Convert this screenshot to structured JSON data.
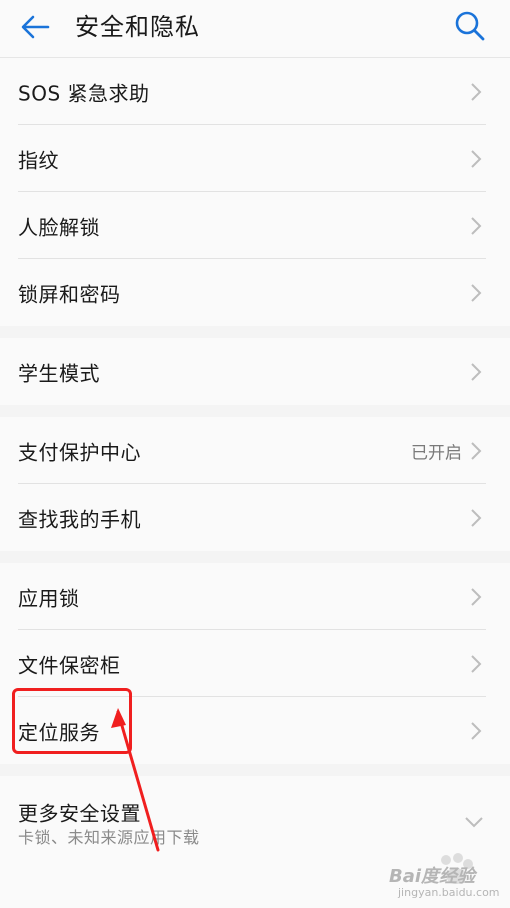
{
  "header": {
    "title": "安全和隐私"
  },
  "groups": [
    {
      "items": [
        {
          "label": "SOS 紧急求助"
        },
        {
          "label": "指纹"
        },
        {
          "label": "人脸解锁"
        },
        {
          "label": "锁屏和密码"
        }
      ]
    },
    {
      "items": [
        {
          "label": "学生模式"
        }
      ]
    },
    {
      "items": [
        {
          "label": "支付保护中心",
          "value": "已开启"
        },
        {
          "label": "查找我的手机"
        }
      ]
    },
    {
      "items": [
        {
          "label": "应用锁"
        },
        {
          "label": "文件保密柜"
        },
        {
          "label": "定位服务"
        }
      ]
    },
    {
      "items": [
        {
          "label": "更多安全设置",
          "sub": "卡锁、未知来源应用下载"
        }
      ]
    }
  ],
  "watermark": {
    "text": "Bai度经验",
    "sub": "jingyan.baidu.com"
  },
  "colors": {
    "accent": "#1a73d9",
    "highlight": "#f01f1f"
  }
}
